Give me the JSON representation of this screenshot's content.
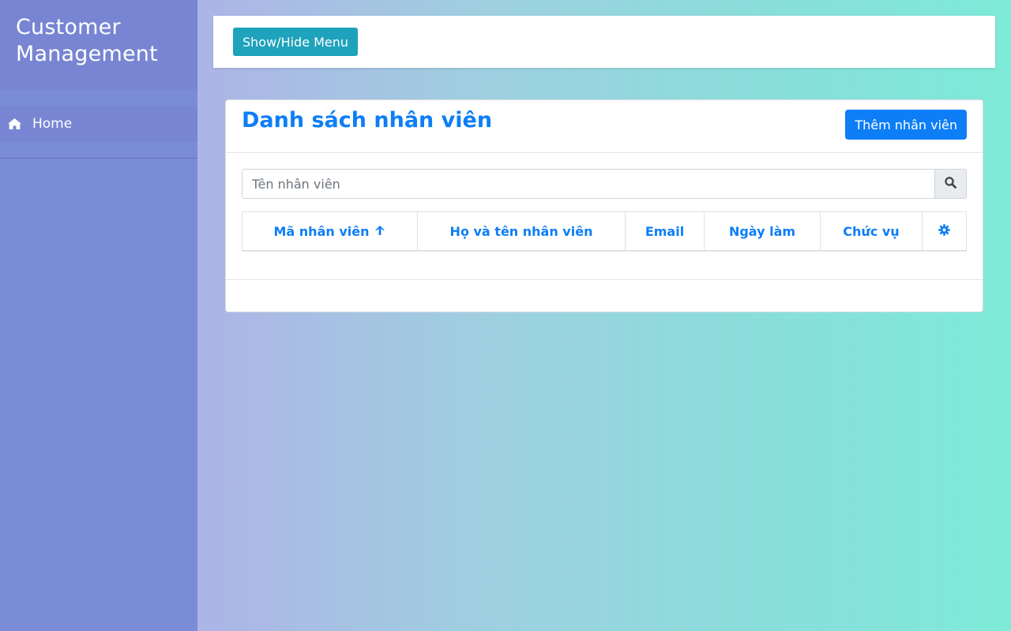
{
  "sidebar": {
    "brand_line1": "Customer",
    "brand_line2": "Management",
    "items": [
      {
        "label": "Home",
        "icon": "home-icon"
      }
    ]
  },
  "topbar": {
    "toggle_label": "Show/Hide Menu"
  },
  "card": {
    "title": "Danh sách nhân viên",
    "add_button_label": "Thêm nhân viên",
    "search": {
      "placeholder": "Tên nhân viên",
      "value": "",
      "icon": "search-icon"
    },
    "table": {
      "columns": [
        {
          "label": "Mã nhân viên",
          "sort": "ascending",
          "icon": "arrow-up-icon"
        },
        {
          "label": "Họ và tên nhân viên"
        },
        {
          "label": "Email"
        },
        {
          "label": "Ngày làm"
        },
        {
          "label": "Chức vụ"
        },
        {
          "label": "",
          "icon": "gear-icon"
        }
      ],
      "rows": []
    }
  },
  "colors": {
    "primary": "#0d7ef5",
    "info": "#1fa2bb",
    "sidebar": "#7a8bd8"
  }
}
